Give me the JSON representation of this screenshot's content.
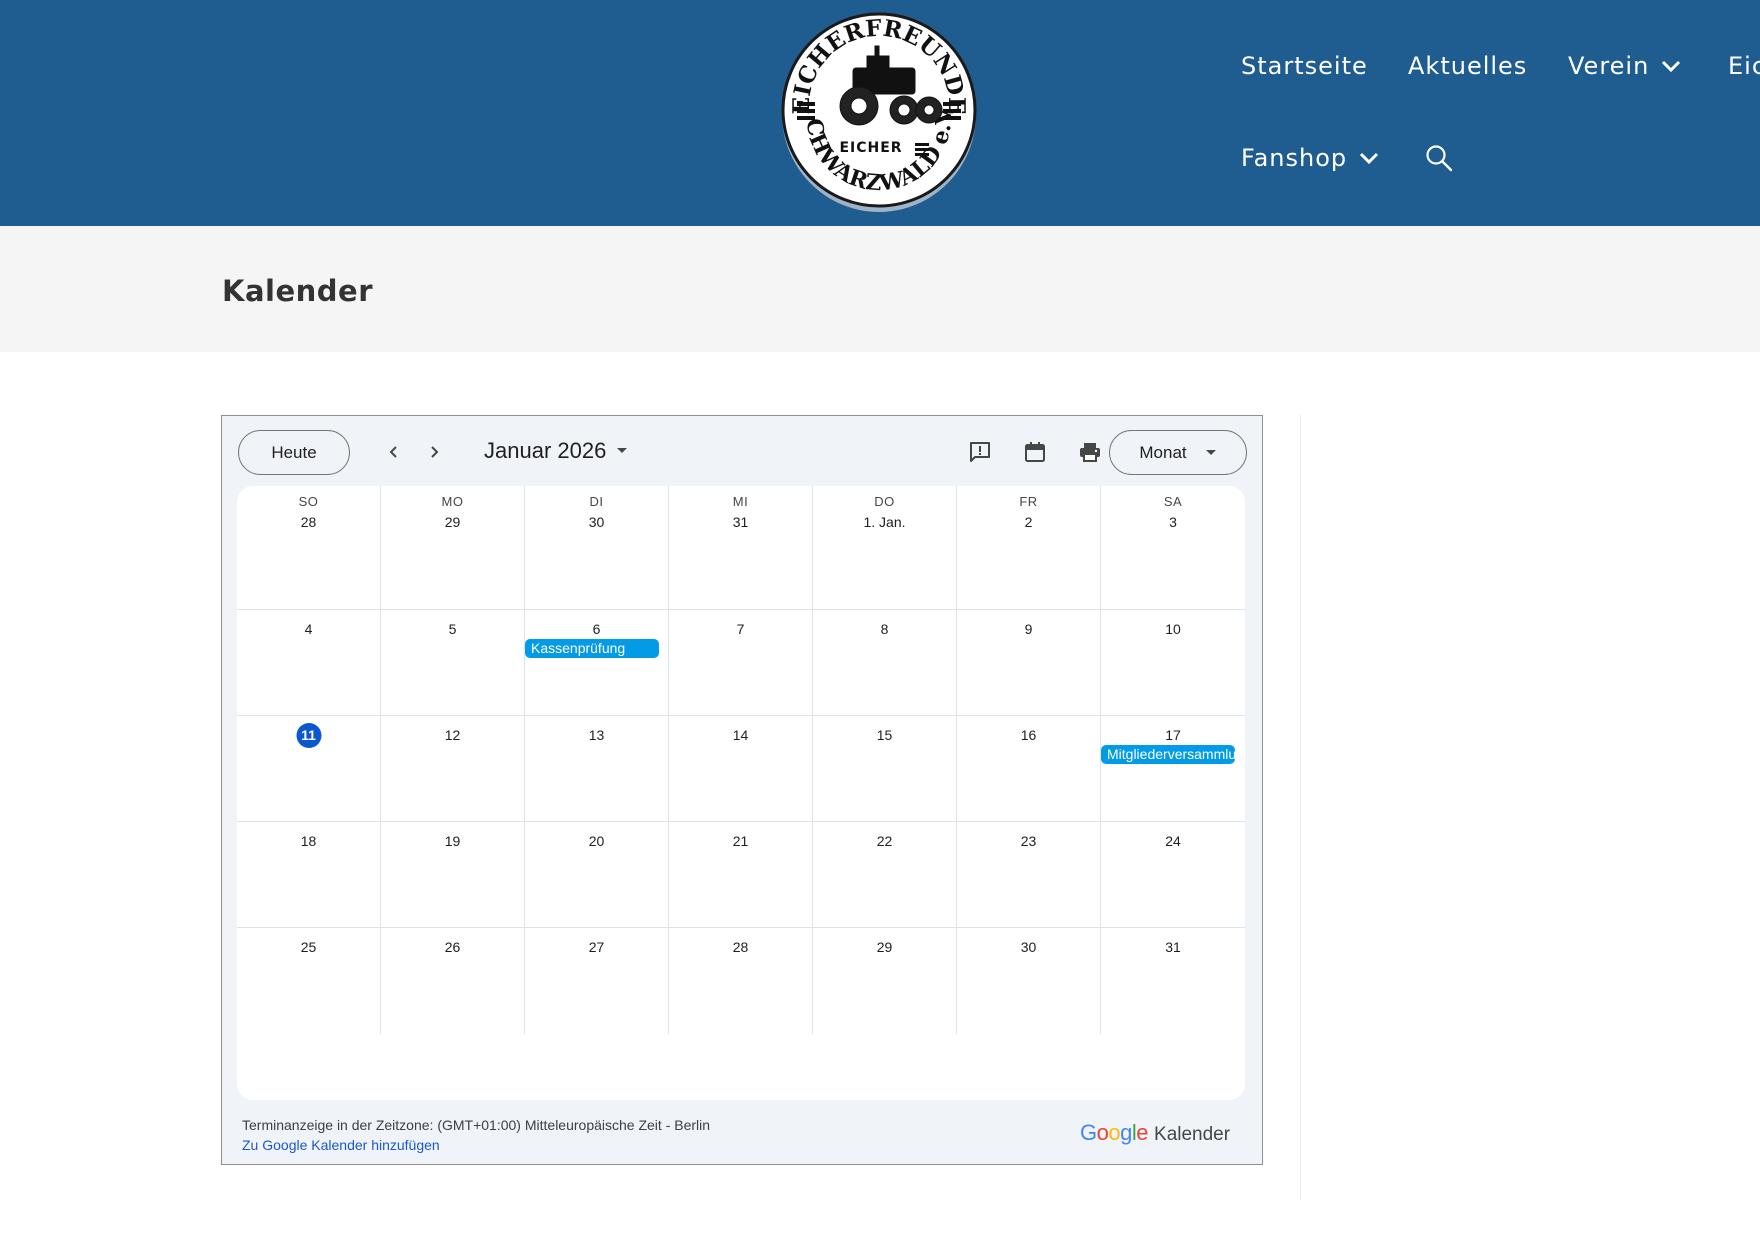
{
  "header": {
    "logo_text": "EICHERFREUNDE SCHWARZWALD e.V. EICHER",
    "nav": [
      {
        "label": "Startseite",
        "has_dropdown": false
      },
      {
        "label": "Aktuelles",
        "has_dropdown": false
      },
      {
        "label": "Verein",
        "has_dropdown": true
      },
      {
        "label": "Eic",
        "has_dropdown": false
      },
      {
        "label": "Fanshop",
        "has_dropdown": true
      }
    ],
    "search_icon": "search-icon"
  },
  "page": {
    "title": "Kalender"
  },
  "calendar": {
    "today_label": "Heute",
    "month_label": "Januar 2026",
    "view_label": "Monat",
    "toolbar_icons": [
      "feedback-icon",
      "calendar-icon",
      "print-icon"
    ],
    "weekdays": [
      "SO",
      "MO",
      "DI",
      "MI",
      "DO",
      "FR",
      "SA"
    ],
    "weeks": [
      [
        "28",
        "29",
        "30",
        "31",
        "1. Jan.",
        "2",
        "3"
      ],
      [
        "4",
        "5",
        "6",
        "7",
        "8",
        "9",
        "10"
      ],
      [
        "11",
        "12",
        "13",
        "14",
        "15",
        "16",
        "17"
      ],
      [
        "18",
        "19",
        "20",
        "21",
        "22",
        "23",
        "24"
      ],
      [
        "25",
        "26",
        "27",
        "28",
        "29",
        "30",
        "31"
      ]
    ],
    "today": {
      "week": 2,
      "day": 0
    },
    "events": [
      {
        "title": "Kassenprüfung",
        "week": 1,
        "day": 2
      },
      {
        "title": "Mitgliederversammlung",
        "week": 2,
        "day": 6
      }
    ],
    "event_color": "#039be5",
    "today_color": "#0b57d0",
    "footer": {
      "timezone": "Terminanzeige in der Zeitzone: (GMT+01:00) Mitteleuropäische Zeit - Berlin",
      "add_link": "Zu Google Kalender hinzufügen",
      "brand_logo": "Google",
      "brand_text": "Kalender"
    }
  },
  "colors": {
    "header_bg": "#1f5c8f",
    "title_band_bg": "#f5f5f5",
    "calendar_bg": "#f0f4f9"
  }
}
